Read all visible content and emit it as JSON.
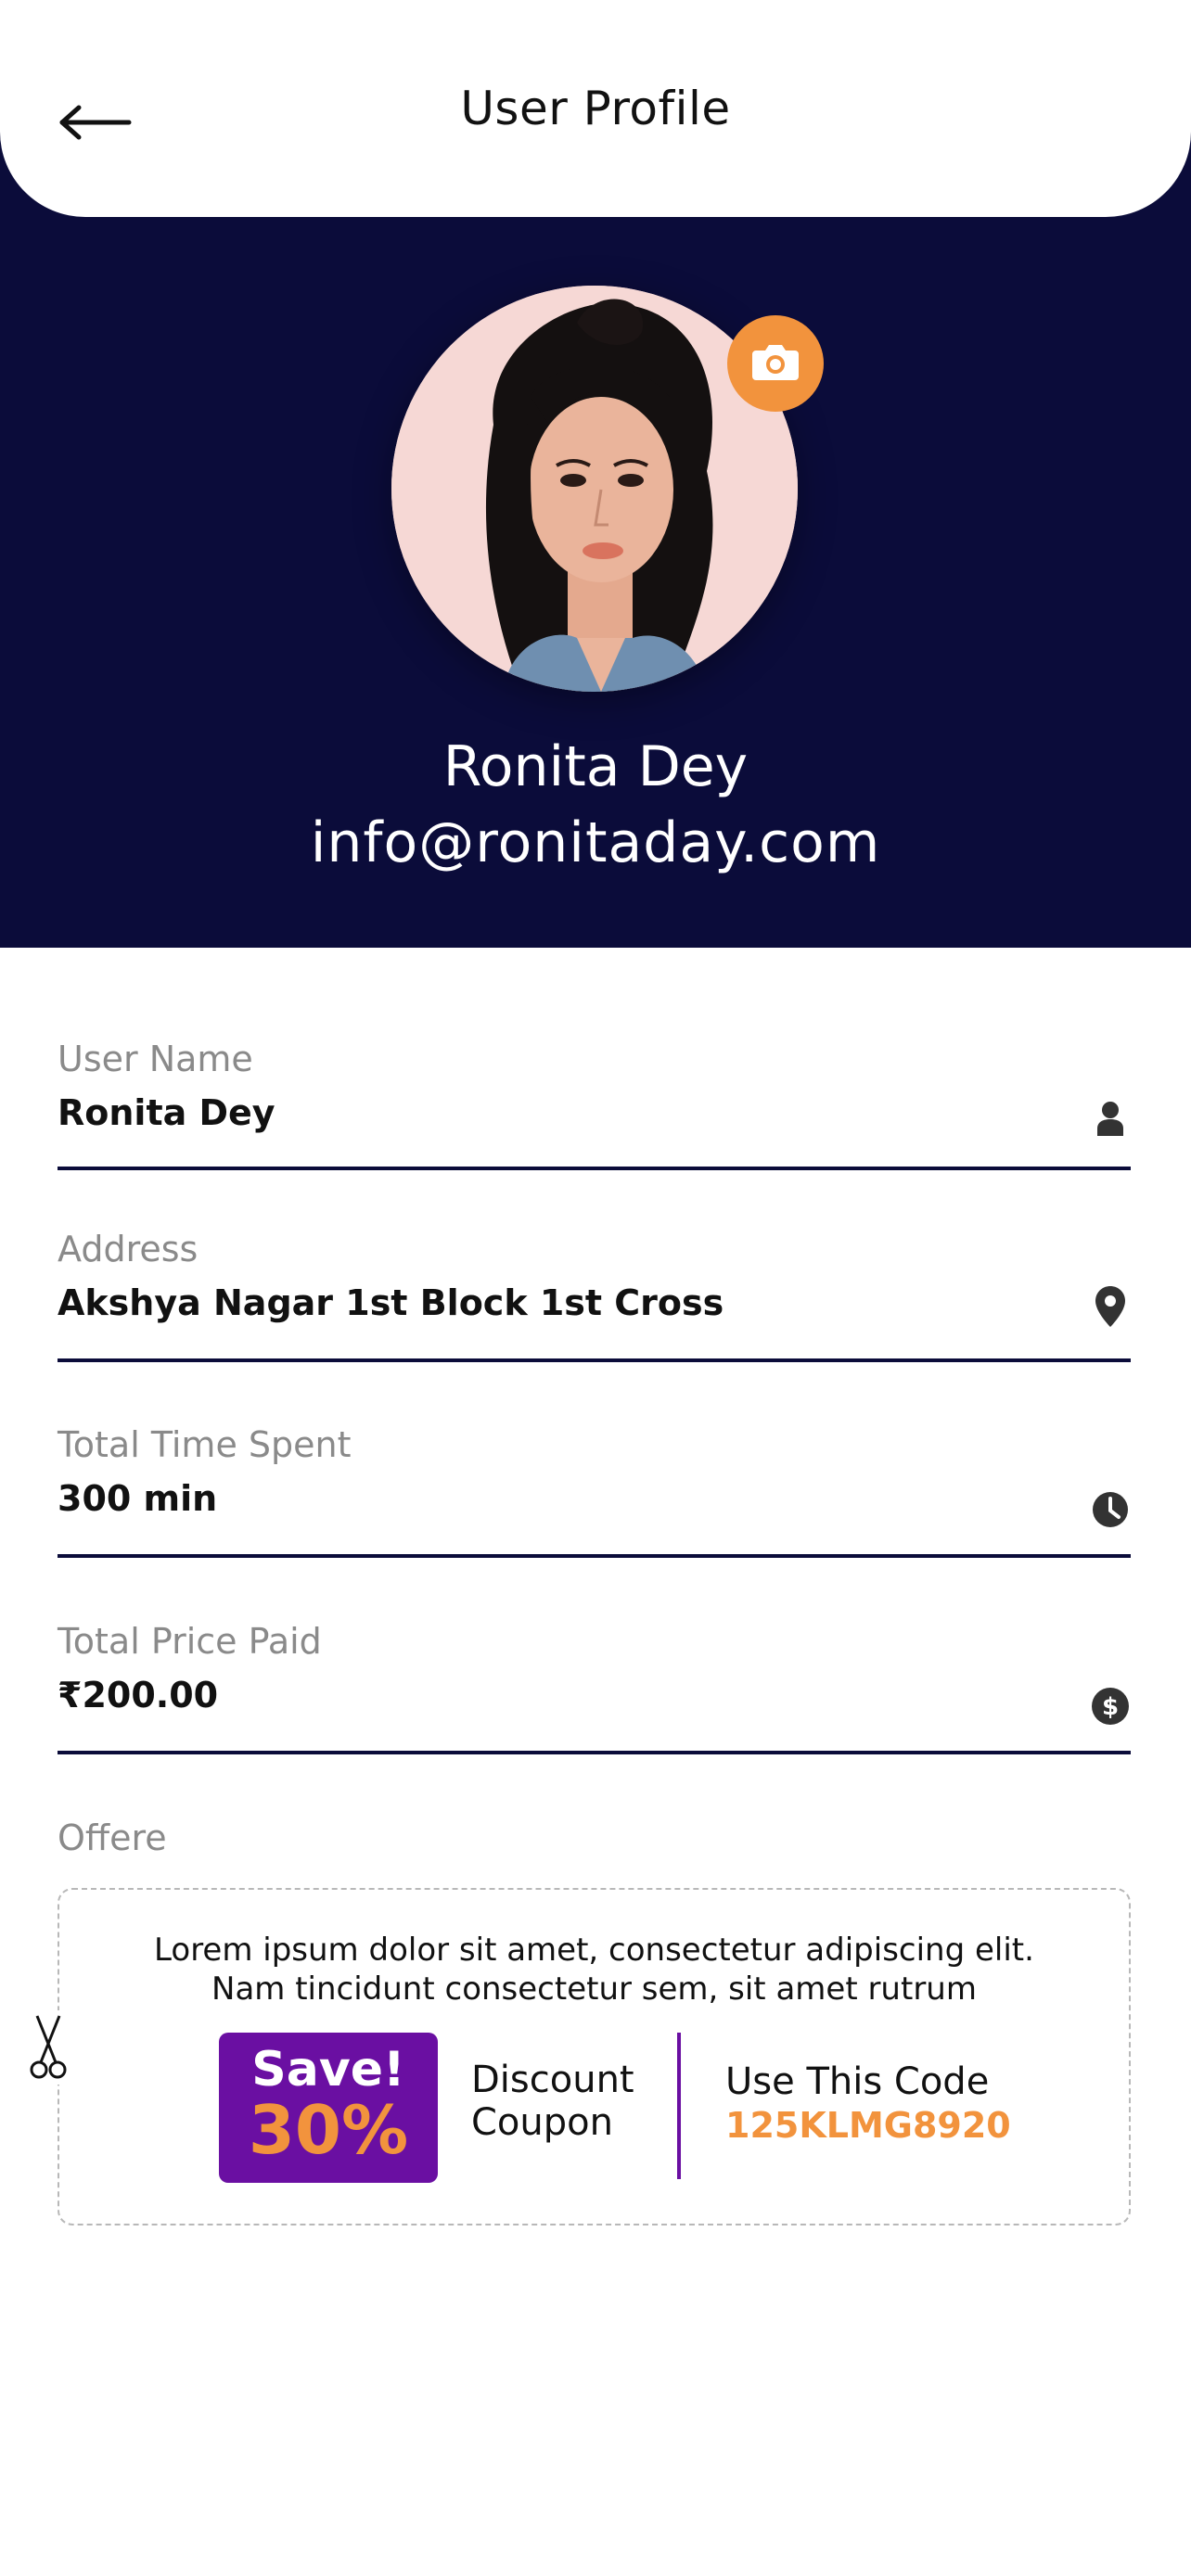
{
  "header": {
    "title": "User Profile",
    "back_icon": "arrow-left-icon"
  },
  "profile": {
    "name": "Ronita Dey",
    "email": "info@ronitaday.com",
    "camera_icon": "camera-icon"
  },
  "fields": [
    {
      "label": "User Name",
      "value": "Ronita Dey",
      "icon": "user-icon"
    },
    {
      "label": "Address",
      "value": "Akshya Nagar 1st Block 1st Cross",
      "icon": "location-pin-icon"
    },
    {
      "label": "Total Time Spent",
      "value": "300 min",
      "icon": "clock-icon"
    },
    {
      "label": "Total Price Paid",
      "value": "₹200.00",
      "icon": "dollar-icon"
    }
  ],
  "offer": {
    "label": "Offere",
    "description_line1": "Lorem ipsum dolor sit amet, consectetur adipiscing elit.",
    "description_line2": "Nam tincidunt consectetur sem, sit amet rutrum",
    "save_text": "Save!",
    "save_percent": "30%",
    "coupon_label_line1": "Discount",
    "coupon_label_line2": "Coupon",
    "code_title": "Use This Code",
    "code_value": "125KLMG8920",
    "scissors_icon": "scissors-icon"
  },
  "colors": {
    "navy": "#0b0c3a",
    "accent_orange": "#f2933d",
    "purple": "#6a0fa2"
  }
}
